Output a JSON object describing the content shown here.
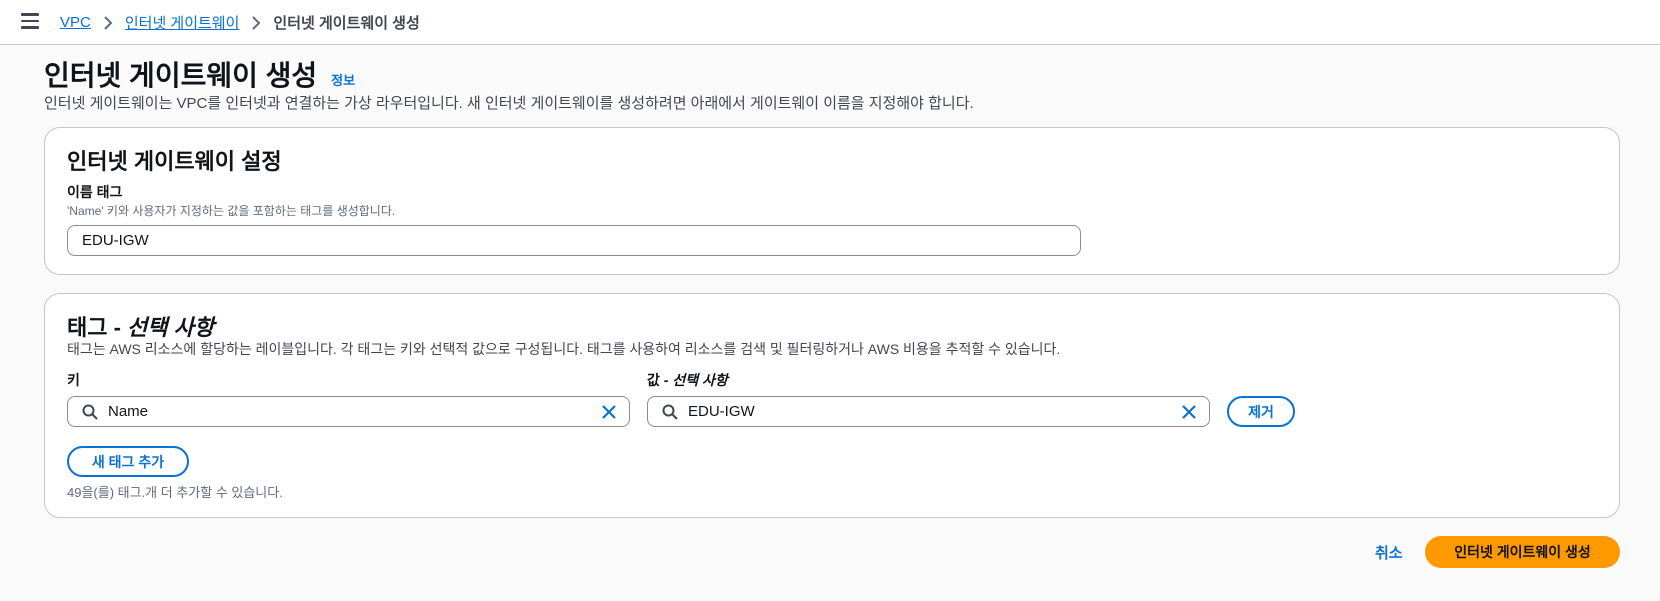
{
  "breadcrumb": {
    "items": [
      "VPC",
      "인터넷 게이트웨이"
    ],
    "current": "인터넷 게이트웨이 생성"
  },
  "header": {
    "title": "인터넷 게이트웨이 생성",
    "info": "정보",
    "description": "인터넷 게이트웨이는 VPC를 인터넷과 연결하는 가상 라우터입니다. 새 인터넷 게이트웨이를 생성하려면 아래에서 게이트웨이 이름을 지정해야 합니다."
  },
  "settings": {
    "title": "인터넷 게이트웨이 설정",
    "name_tag_label": "이름 태그",
    "name_tag_hint": "'Name' 키와 사용자가 지정하는 값을 포함하는 태그를 생성합니다.",
    "name_tag_value": "EDU-IGW"
  },
  "tags": {
    "title_main": "태그 - ",
    "title_optional": "선택 사항",
    "description": "태그는 AWS 리소스에 할당하는 레이블입니다. 각 태그는 키와 선택적 값으로 구성됩니다. 태그를 사용하여 리소스를 검색 및 필터링하거나 AWS 비용을 추적할 수 있습니다.",
    "key_label": "키",
    "value_label_main": "값 - ",
    "value_label_optional": "선택 사항",
    "rows": [
      {
        "key": "Name",
        "value": "EDU-IGW",
        "remove_label": "제거"
      }
    ],
    "add_label": "새 태그 추가",
    "remaining_text": "49을(를) 태그.개 더 추가할 수 있습니다."
  },
  "footer": {
    "cancel_label": "취소",
    "submit_label": "인터넷 게이트웨이 생성"
  },
  "colors": {
    "link": "#0972d3",
    "primary": "#ff9900",
    "border": "#c6c6cd"
  }
}
